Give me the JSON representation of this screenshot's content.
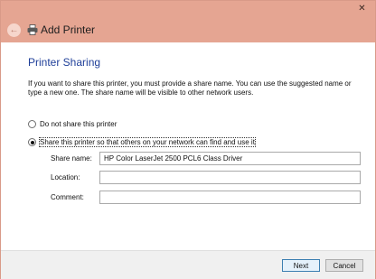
{
  "window": {
    "title": "Add Printer",
    "close_glyph": "✕"
  },
  "page": {
    "heading": "Printer Sharing",
    "description": "If you want to share this printer, you must provide a share name. You can use the suggested name or type a new one. The share name will be visible to other network users."
  },
  "options": {
    "no_share_label": "Do not share this printer",
    "share_label": "Share this printer so that others on your network can find and use it",
    "selected": "share"
  },
  "fields": {
    "share_name_label": "Share name:",
    "share_name_value": "HP Color LaserJet 2500 PCL6 Class Driver",
    "location_label": "Location:",
    "location_value": "",
    "comment_label": "Comment:",
    "comment_value": ""
  },
  "buttons": {
    "next": "Next",
    "cancel": "Cancel"
  },
  "colors": {
    "titlebar": "#e5a592",
    "heading": "#1f3f99"
  }
}
